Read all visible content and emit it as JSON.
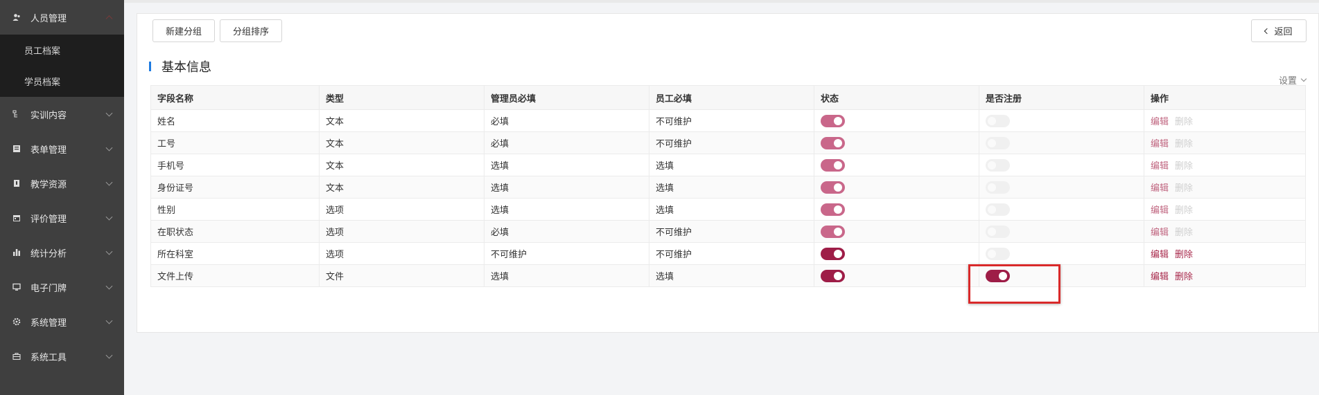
{
  "sidebar": {
    "groups": [
      {
        "label": "人员管理",
        "icon": "people-icon",
        "open": true,
        "sub": [
          "员工档案",
          "学员档案"
        ]
      },
      {
        "label": "实训内容",
        "icon": "tree-icon"
      },
      {
        "label": "表单管理",
        "icon": "form-icon"
      },
      {
        "label": "教学资源",
        "icon": "book-icon"
      },
      {
        "label": "评价管理",
        "icon": "calendar-icon"
      },
      {
        "label": "统计分析",
        "icon": "bar-chart-icon"
      },
      {
        "label": "电子门牌",
        "icon": "monitor-icon"
      },
      {
        "label": "系统管理",
        "icon": "gear-icon"
      },
      {
        "label": "系统工具",
        "icon": "toolbox-icon"
      }
    ]
  },
  "toolbar": {
    "new_group": "新建分组",
    "sort_group": "分组排序",
    "back": "返回"
  },
  "section": {
    "title": "基本信息",
    "settings": "设置"
  },
  "table": {
    "headers": [
      "字段名称",
      "类型",
      "管理员必填",
      "员工必填",
      "状态",
      "是否注册",
      "操作"
    ],
    "rows": [
      {
        "name": "姓名",
        "type": "文本",
        "admin": "必填",
        "staff": "不可维护",
        "status": "on-dim",
        "reg": "off",
        "edit": "编辑",
        "del": "删除",
        "actions_enabled": false
      },
      {
        "name": "工号",
        "type": "文本",
        "admin": "必填",
        "staff": "不可维护",
        "status": "on-dim",
        "reg": "off",
        "edit": "编辑",
        "del": "删除",
        "actions_enabled": false
      },
      {
        "name": "手机号",
        "type": "文本",
        "admin": "选填",
        "staff": "选填",
        "status": "on-dim",
        "reg": "off",
        "edit": "编辑",
        "del": "删除",
        "actions_enabled": false
      },
      {
        "name": "身份证号",
        "type": "文本",
        "admin": "选填",
        "staff": "选填",
        "status": "on-dim",
        "reg": "off",
        "edit": "编辑",
        "del": "删除",
        "actions_enabled": false
      },
      {
        "name": "性别",
        "type": "选项",
        "admin": "选填",
        "staff": "选填",
        "status": "on-dim",
        "reg": "off",
        "edit": "编辑",
        "del": "删除",
        "actions_enabled": false
      },
      {
        "name": "在职状态",
        "type": "选项",
        "admin": "必填",
        "staff": "不可维护",
        "status": "on-dim",
        "reg": "off",
        "edit": "编辑",
        "del": "删除",
        "actions_enabled": false
      },
      {
        "name": "所在科室",
        "type": "选项",
        "admin": "不可维护",
        "staff": "不可维护",
        "status": "on-strong",
        "reg": "off",
        "edit": "编辑",
        "del": "删除",
        "actions_enabled": true
      },
      {
        "name": "文件上传",
        "type": "文件",
        "admin": "选填",
        "staff": "选填",
        "status": "on-strong",
        "reg": "on-strong",
        "edit": "编辑",
        "del": "删除",
        "actions_enabled": true
      }
    ]
  },
  "colors": {
    "accent": "#9e1d47",
    "accent_dim": "#c9678a",
    "sidebar_bg": "#3f3f3f",
    "highlight": "#d9292a"
  }
}
